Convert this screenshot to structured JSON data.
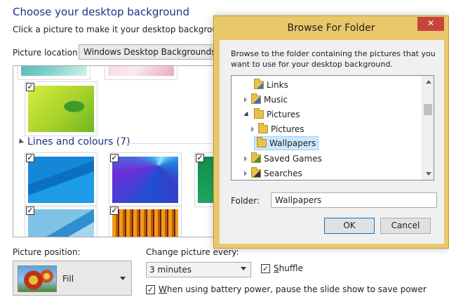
{
  "page": {
    "title": "Choose your desktop background",
    "description": "Click a picture to make it your desktop background, or",
    "location_label": "Picture location:",
    "location_value": "Windows Desktop Backgrounds",
    "group_title": "Lines and colours (7)",
    "position_label": "Picture position:",
    "position_value": "Fill",
    "change_label": "Change picture every:",
    "change_value": "3 minutes",
    "shuffle_label_u": "S",
    "shuffle_label_rest": "huffle",
    "shuffle_checked": true,
    "battery_label_u": "W",
    "battery_label_rest": "hen using battery power, pause the slide show to save power",
    "battery_checked": true
  },
  "dialog": {
    "title": "Browse For Folder",
    "close_glyph": "✕",
    "description": "Browse to the folder containing the pictures that you want to use for your desktop background.",
    "tree": [
      {
        "label": "Links",
        "icon": "links-folder-icon",
        "expander": "none"
      },
      {
        "label": "Music",
        "icon": "music-folder-icon",
        "expander": "collapsed"
      },
      {
        "label": "Pictures",
        "icon": "folder-icon",
        "expander": "expanded"
      },
      {
        "label": "Pictures",
        "icon": "folder-icon",
        "expander": "collapsed"
      },
      {
        "label": "Wallpapers",
        "icon": "folder-icon",
        "expander": "none",
        "selected": true
      },
      {
        "label": "Saved Games",
        "icon": "saved-games-folder-icon",
        "expander": "collapsed"
      },
      {
        "label": "Searches",
        "icon": "search-folder-icon",
        "expander": "collapsed"
      }
    ],
    "folder_label": "Folder:",
    "folder_value": "Wallpapers",
    "ok_label": "OK",
    "cancel_label": "Cancel"
  },
  "colors": {
    "title_blue": "#1e3287",
    "dialog_frame": "#e9c86b",
    "close_red": "#c7443c",
    "selection": "#cce8ff"
  }
}
